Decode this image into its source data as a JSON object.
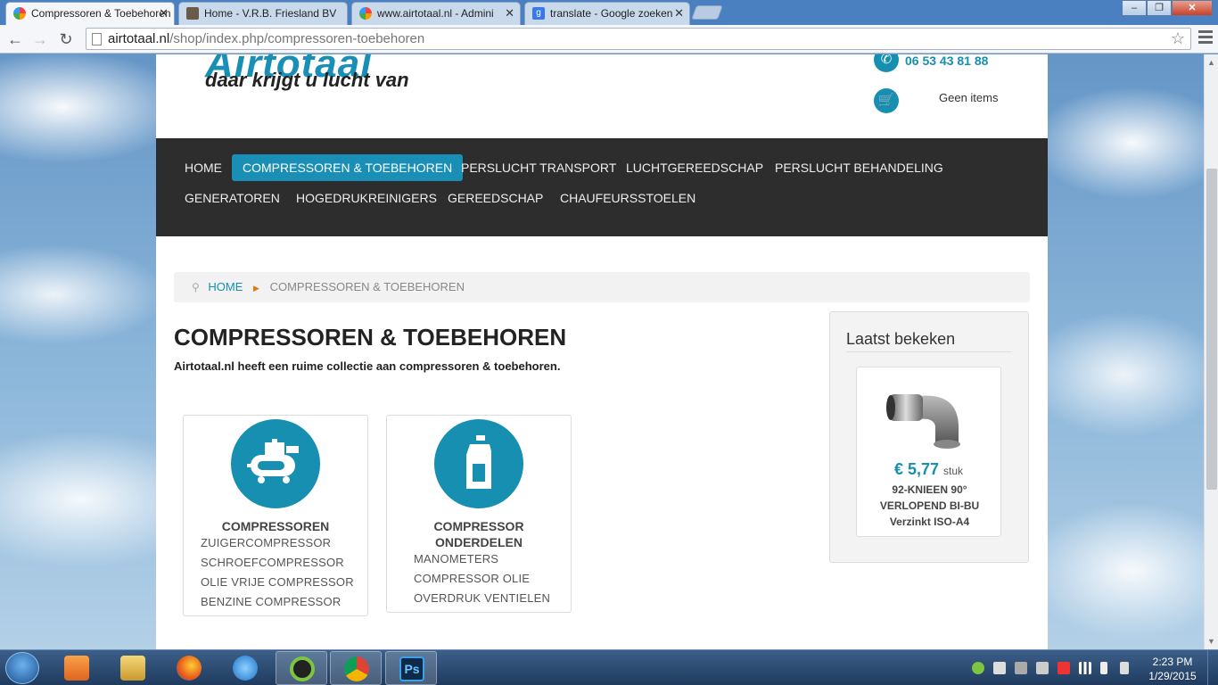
{
  "browser": {
    "tabs": [
      {
        "title": "Compressoren & Toebehoren",
        "active": true
      },
      {
        "title": "Home - V.R.B. Friesland BV",
        "active": false
      },
      {
        "title": "www.airtotaal.nl - Admini",
        "active": false
      },
      {
        "title": "translate - Google zoeken",
        "active": false
      }
    ],
    "url_domain": "airtotaal.nl",
    "url_path": "/shop/index.php/compressoren-toebehoren"
  },
  "header": {
    "logo_name": "Airtotaal",
    "logo_tagline": "daar krijgt u lucht van",
    "phone": "06 53 43 81 88",
    "cart_text": "Geen items"
  },
  "nav": {
    "items": [
      {
        "label": "HOME",
        "active": false
      },
      {
        "label": "COMPRESSOREN & TOEBEHOREN",
        "active": true
      },
      {
        "label": "PERSLUCHT TRANSPORT",
        "active": false
      },
      {
        "label": "LUCHTGEREEDSCHAP",
        "active": false
      },
      {
        "label": "PERSLUCHT BEHANDELING",
        "active": false
      },
      {
        "label": "GENERATOREN",
        "active": false
      },
      {
        "label": "HOGEDRUKREINIGERS",
        "active": false
      },
      {
        "label": "GEREEDSCHAP",
        "active": false
      },
      {
        "label": "CHAUFEURSSTOELEN",
        "active": false
      }
    ]
  },
  "breadcrumb": {
    "home": "HOME",
    "current": "COMPRESSOREN & TOEBEHOREN"
  },
  "main": {
    "title": "COMPRESSOREN & TOEBEHOREN",
    "intro": "Airtotaal.nl heeft een ruime collectie aan compressoren & toebehoren.",
    "categories": [
      {
        "title": "COMPRESSOREN",
        "icon": "compressor-icon",
        "links": [
          "ZUIGERCOMPRESSOR",
          "SCHROEFCOMPRESSOR",
          "OLIE VRIJE COMPRESSOR",
          "BENZINE COMPRESSOR"
        ]
      },
      {
        "title_line1": "COMPRESSOR",
        "title_line2": "ONDERDELEN",
        "icon": "oil-bottle-icon",
        "links": [
          "MANOMETERS",
          "COMPRESSOR OLIE",
          "OVERDRUK VENTIELEN"
        ]
      }
    ]
  },
  "sidebar": {
    "title": "Laatst bekeken",
    "product": {
      "price": "€ 5,77",
      "unit": "stuk",
      "name": "92-KNIEEN 90° VERLOPEND BI-BU Verzinkt ISO-A4"
    }
  },
  "taskbar": {
    "apps": [
      "media-player-icon",
      "file-explorer-icon",
      "firefox-icon",
      "internet-explorer-icon",
      "spotify-icon",
      "chrome-icon",
      "photoshop-icon"
    ],
    "time": "2:23 PM",
    "date": "1/29/2015"
  },
  "colors": {
    "accent": "#168fb0",
    "nav_bg": "#2d2d2d",
    "nav_active": "#1a8fb6"
  }
}
